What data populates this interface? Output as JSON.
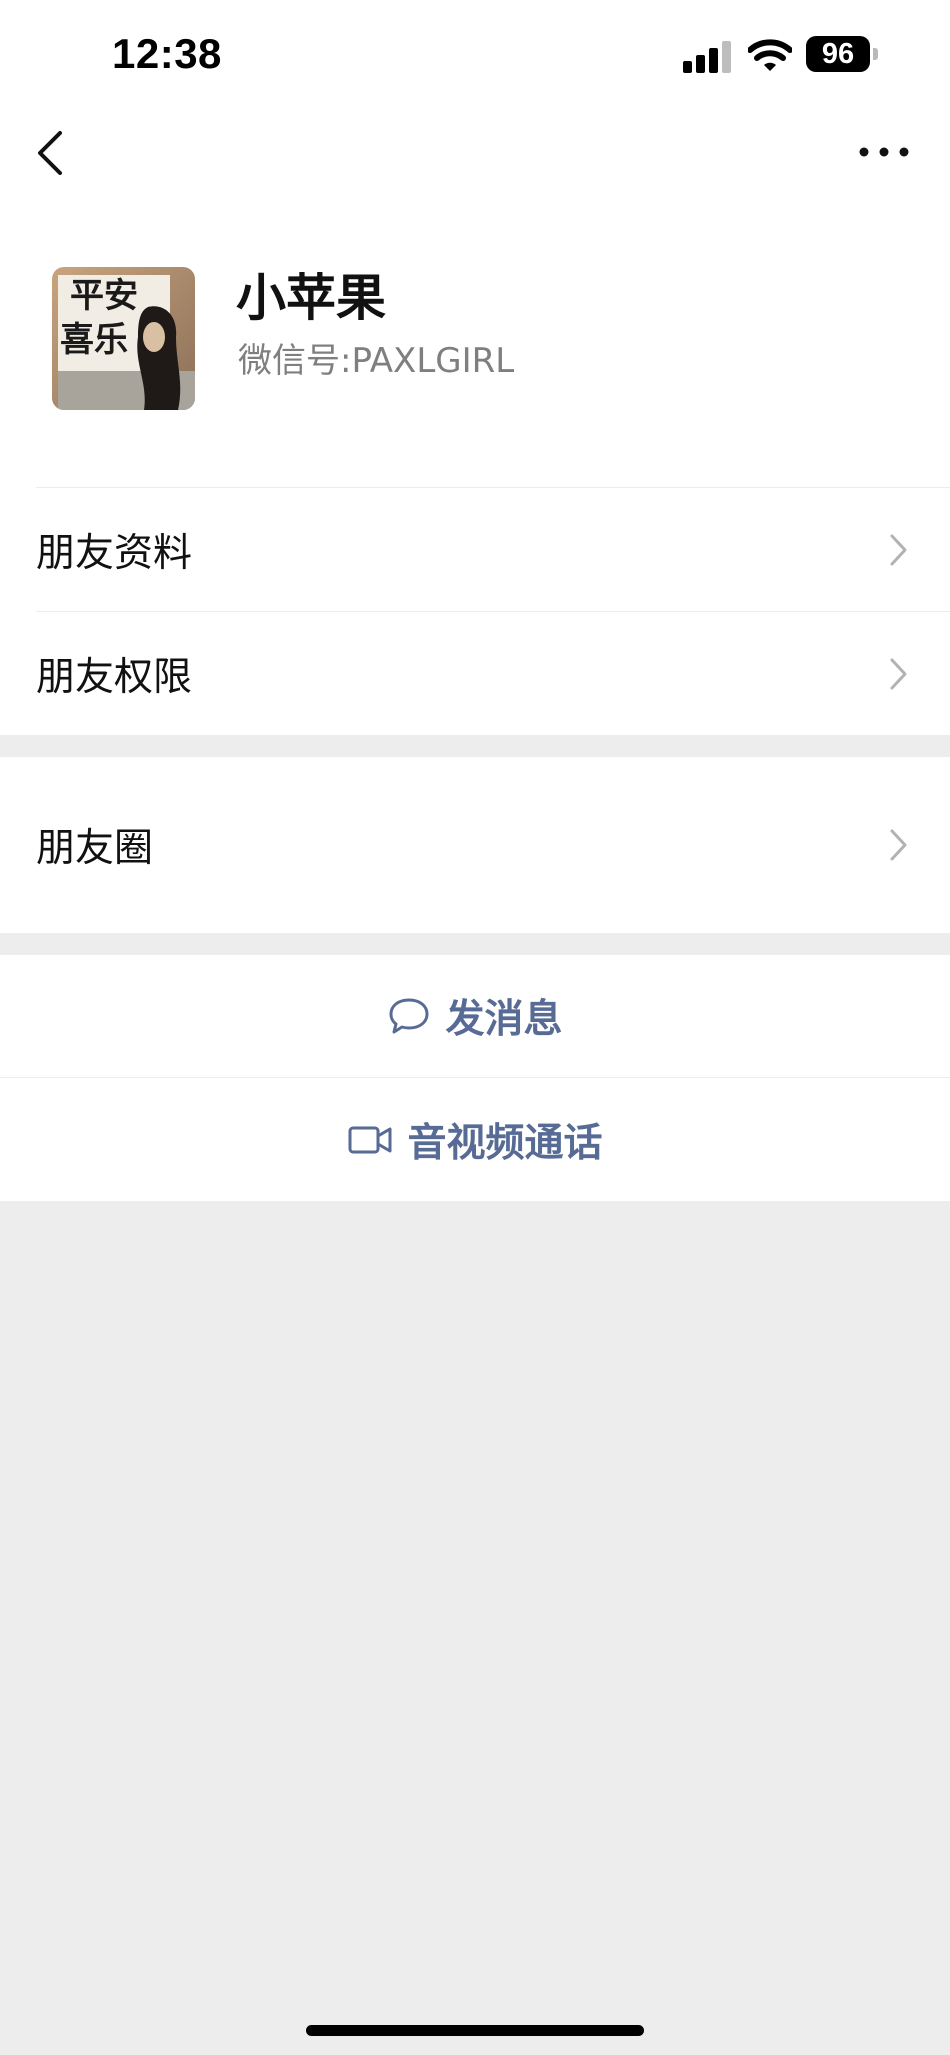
{
  "status_bar": {
    "time": "12:38",
    "battery": "96"
  },
  "nav": {
    "back_icon": "chevron-left-icon",
    "more_icon": "more-dots-icon"
  },
  "profile": {
    "name": "小苹果",
    "wechat_id": "微信号:PAXLGIRL",
    "avatar_text_1": "平安",
    "avatar_text_2": "喜乐"
  },
  "menu": {
    "friend_info": "朋友资料",
    "friend_permissions": "朋友权限",
    "moments": "朋友圈"
  },
  "actions": {
    "send_message": "发消息",
    "av_call": "音视频通话"
  },
  "colors": {
    "accent": "#576b95",
    "background": "#ededed"
  }
}
